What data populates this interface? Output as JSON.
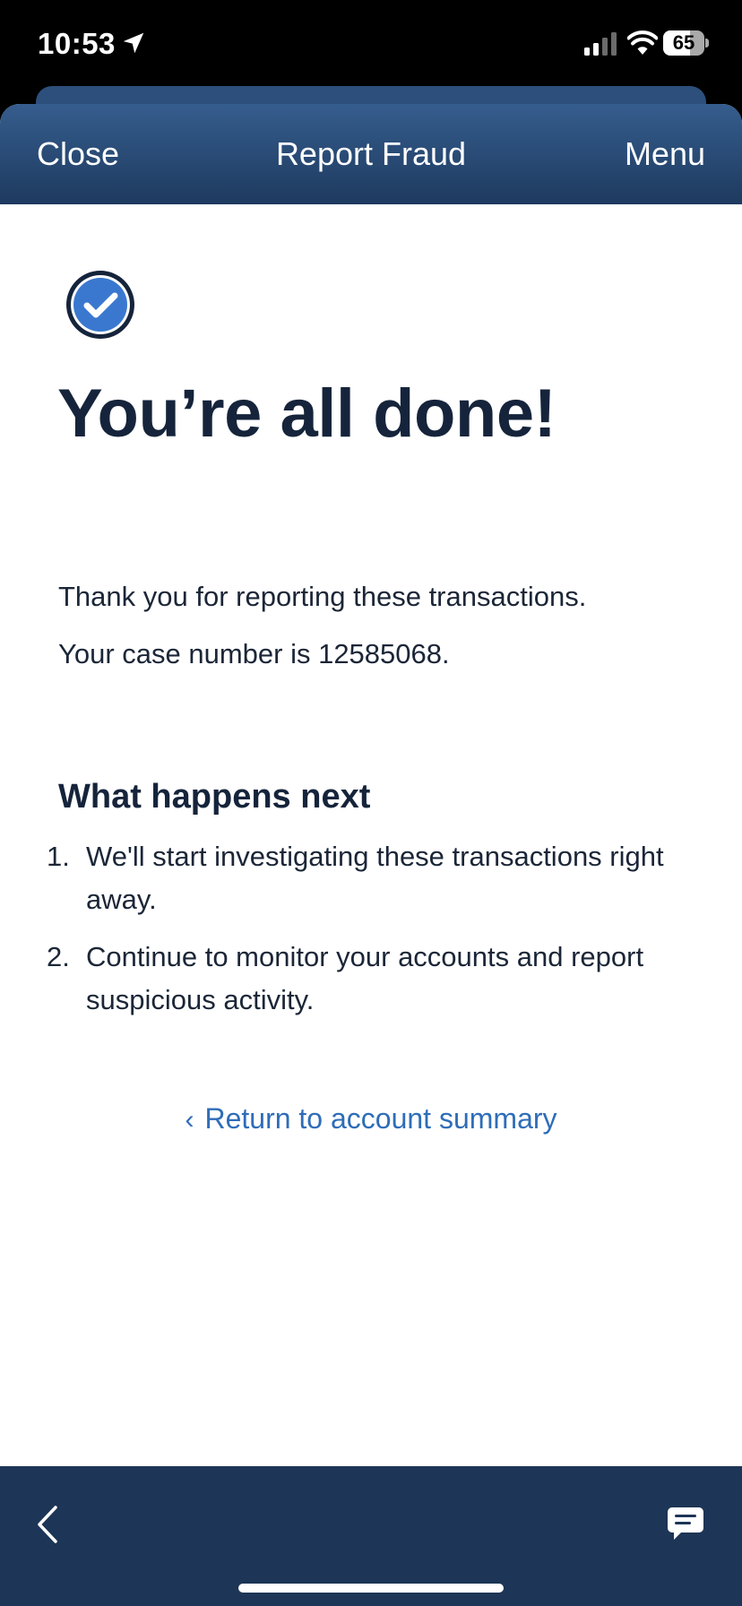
{
  "status_bar": {
    "time": "10:53",
    "battery_level": "65",
    "battery_fraction": 0.65,
    "icons": [
      "location-arrow-icon",
      "cellular-signal-icon",
      "wifi-icon",
      "battery-icon"
    ]
  },
  "nav": {
    "close_label": "Close",
    "title": "Report Fraud",
    "menu_label": "Menu"
  },
  "main": {
    "headline": "You’re all done!",
    "thanks_text": "Thank you for reporting these transactions.",
    "case_prefix": "Your case number is ",
    "case_number": "12585068",
    "case_suffix": ".",
    "section_title": "What happens next",
    "steps": [
      {
        "num": "1.",
        "text": "We'll start investigating these transactions right away."
      },
      {
        "num": "2.",
        "text": "Continue to monitor your accounts and report suspicious activity."
      }
    ],
    "return_link": "Return to account summary"
  },
  "bottom_bar": {
    "icons": [
      "back-chevron-icon",
      "chat-icon"
    ]
  },
  "colors": {
    "nav_top": "#355d8d",
    "nav_bottom": "#1e3a5f",
    "bottom_bar": "#1d3556",
    "headline": "#15243b",
    "link": "#2f6db8",
    "check_fill": "#3a78d0"
  }
}
